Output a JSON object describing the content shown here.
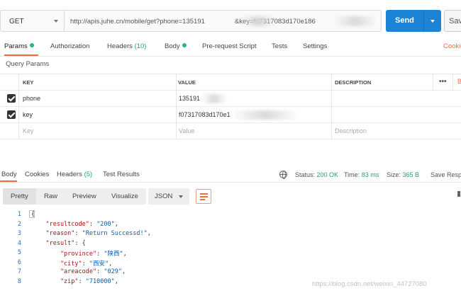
{
  "request": {
    "method": "GET",
    "url": "http://apis.juhe.cn/mobile/get?phone=135191",
    "url_suffix": "&key=f07317083d170e186",
    "send_label": "Send",
    "save_label": "Sav"
  },
  "tabs": [
    {
      "label": "Params",
      "dot": true
    },
    {
      "label": "Authorization"
    },
    {
      "label": "Headers",
      "count": "(10)"
    },
    {
      "label": "Body",
      "dot": true
    },
    {
      "label": "Pre-request Script"
    },
    {
      "label": "Tests"
    },
    {
      "label": "Settings"
    }
  ],
  "cookies_label": "Cookie",
  "query_params": {
    "title": "Query Params",
    "headers": [
      "KEY",
      "VALUE",
      "DESCRIPTION"
    ],
    "rows": [
      {
        "key": "phone",
        "value": "135191",
        "description": ""
      },
      {
        "key": "key",
        "value": "f07317083d170e1",
        "description": ""
      }
    ],
    "placeholder": {
      "key": "Key",
      "value": "Value",
      "description": "Description"
    },
    "more_label": "•••",
    "bulk_label": "B"
  },
  "response": {
    "tabs": [
      {
        "label": "Body"
      },
      {
        "label": "Cookies"
      },
      {
        "label": "Headers",
        "count": "(5)"
      },
      {
        "label": "Test Results"
      }
    ],
    "status_label": "Status:",
    "status_value": "200 OK",
    "time_label": "Time:",
    "time_value": "83 ms",
    "size_label": "Size:",
    "size_value": "365 B",
    "save_response": "Save Resp",
    "view_modes": [
      "Pretty",
      "Raw",
      "Preview",
      "Visualize"
    ],
    "format": "JSON",
    "code_lines": [
      {
        "n": "1",
        "parts": [
          [
            "pun",
            "{"
          ]
        ]
      },
      {
        "n": "2",
        "parts": [
          [
            "key",
            "    \"resultcode\""
          ],
          [
            "pun",
            ": "
          ],
          [
            "str",
            "\"200\""
          ],
          [
            "pun",
            ","
          ]
        ]
      },
      {
        "n": "3",
        "parts": [
          [
            "key",
            "    \"reason\""
          ],
          [
            "pun",
            ": "
          ],
          [
            "str",
            "\"Return Successd!\""
          ],
          [
            "pun",
            ","
          ]
        ]
      },
      {
        "n": "4",
        "parts": [
          [
            "key",
            "    \"result\""
          ],
          [
            "pun",
            ": {"
          ]
        ]
      },
      {
        "n": "5",
        "parts": [
          [
            "key",
            "        \"province\""
          ],
          [
            "pun",
            ": "
          ],
          [
            "str",
            "\"陕西\""
          ],
          [
            "pun",
            ","
          ]
        ]
      },
      {
        "n": "6",
        "parts": [
          [
            "key",
            "        \"city\""
          ],
          [
            "pun",
            ": "
          ],
          [
            "str",
            "\"西安\""
          ],
          [
            "pun",
            ","
          ]
        ]
      },
      {
        "n": "7",
        "parts": [
          [
            "key",
            "        \"areacode\""
          ],
          [
            "pun",
            ": "
          ],
          [
            "str",
            "\"029\""
          ],
          [
            "pun",
            ","
          ]
        ]
      },
      {
        "n": "8",
        "parts": [
          [
            "key",
            "        \"zip\""
          ],
          [
            "pun",
            ": "
          ],
          [
            "str",
            "\"710000\""
          ],
          [
            "pun",
            ","
          ]
        ]
      }
    ]
  },
  "watermark": "https://blog.csdn.net/weixin_44727080",
  "colors": {
    "accent": "#f26b3a",
    "send": "#1c84d6",
    "status_ok": "#26a36b",
    "dot": "#26b47f"
  }
}
